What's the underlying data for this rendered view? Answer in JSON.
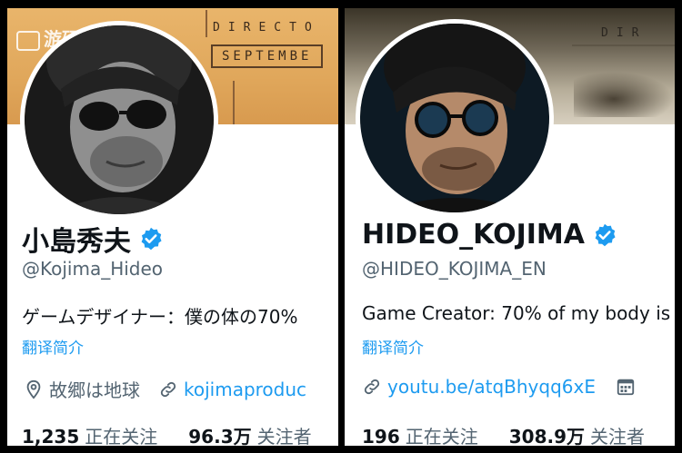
{
  "watermark": "游研社",
  "left": {
    "banner_word": "DIRECTO",
    "banner_box": "SEPTEMBE",
    "name": "小島秀夫",
    "handle": "@Kojima_Hideo",
    "bio": "ゲームデザイナー：僕の体の70%",
    "translate": "翻译简介",
    "location": "故郷は地球",
    "link": "kojimaproduc",
    "following_count": "1,235",
    "following_label": "正在关注",
    "followers_count": "96.3万",
    "followers_label": "关注者"
  },
  "right": {
    "banner_word": "DIR",
    "name": "HIDEO_KOJIMA",
    "handle": "@HIDEO_KOJIMA_EN",
    "bio": "Game Creator: 70% of my body is",
    "translate": "翻译简介",
    "link": "youtu.be/atqBhyqq6xE",
    "following_count": "196",
    "following_label": "正在关注",
    "followers_count": "308.9万",
    "followers_label": "关注者"
  },
  "colors": {
    "verified": "#1d9bf0",
    "link": "#1d9bf0",
    "secondary": "#536471",
    "primary": "#0f1419"
  },
  "icons": [
    "verified-badge-icon",
    "location-pin-icon",
    "link-icon",
    "calendar-icon"
  ]
}
